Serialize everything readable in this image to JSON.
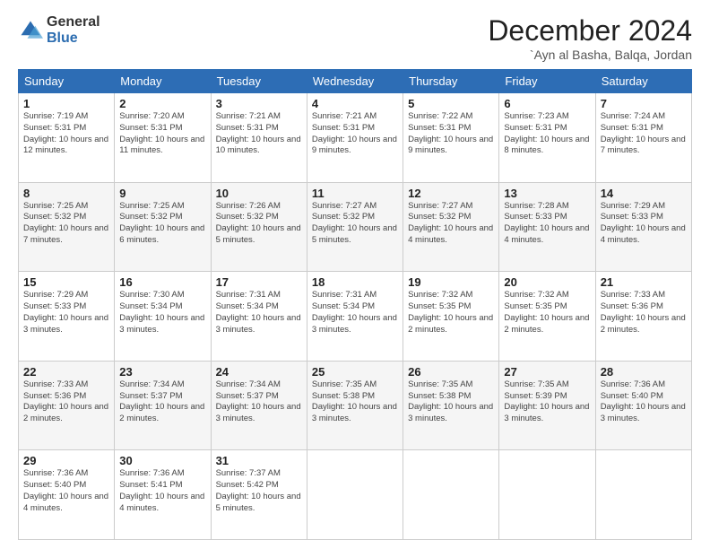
{
  "logo": {
    "general": "General",
    "blue": "Blue"
  },
  "title": "December 2024",
  "location": "`Ayn al Basha, Balqa, Jordan",
  "days_of_week": [
    "Sunday",
    "Monday",
    "Tuesday",
    "Wednesday",
    "Thursday",
    "Friday",
    "Saturday"
  ],
  "weeks": [
    [
      {
        "day": "1",
        "sunrise": "7:19 AM",
        "sunset": "5:31 PM",
        "daylight": "10 hours and 12 minutes."
      },
      {
        "day": "2",
        "sunrise": "7:20 AM",
        "sunset": "5:31 PM",
        "daylight": "10 hours and 11 minutes."
      },
      {
        "day": "3",
        "sunrise": "7:21 AM",
        "sunset": "5:31 PM",
        "daylight": "10 hours and 10 minutes."
      },
      {
        "day": "4",
        "sunrise": "7:21 AM",
        "sunset": "5:31 PM",
        "daylight": "10 hours and 9 minutes."
      },
      {
        "day": "5",
        "sunrise": "7:22 AM",
        "sunset": "5:31 PM",
        "daylight": "10 hours and 9 minutes."
      },
      {
        "day": "6",
        "sunrise": "7:23 AM",
        "sunset": "5:31 PM",
        "daylight": "10 hours and 8 minutes."
      },
      {
        "day": "7",
        "sunrise": "7:24 AM",
        "sunset": "5:31 PM",
        "daylight": "10 hours and 7 minutes."
      }
    ],
    [
      {
        "day": "8",
        "sunrise": "7:25 AM",
        "sunset": "5:32 PM",
        "daylight": "10 hours and 7 minutes."
      },
      {
        "day": "9",
        "sunrise": "7:25 AM",
        "sunset": "5:32 PM",
        "daylight": "10 hours and 6 minutes."
      },
      {
        "day": "10",
        "sunrise": "7:26 AM",
        "sunset": "5:32 PM",
        "daylight": "10 hours and 5 minutes."
      },
      {
        "day": "11",
        "sunrise": "7:27 AM",
        "sunset": "5:32 PM",
        "daylight": "10 hours and 5 minutes."
      },
      {
        "day": "12",
        "sunrise": "7:27 AM",
        "sunset": "5:32 PM",
        "daylight": "10 hours and 4 minutes."
      },
      {
        "day": "13",
        "sunrise": "7:28 AM",
        "sunset": "5:33 PM",
        "daylight": "10 hours and 4 minutes."
      },
      {
        "day": "14",
        "sunrise": "7:29 AM",
        "sunset": "5:33 PM",
        "daylight": "10 hours and 4 minutes."
      }
    ],
    [
      {
        "day": "15",
        "sunrise": "7:29 AM",
        "sunset": "5:33 PM",
        "daylight": "10 hours and 3 minutes."
      },
      {
        "day": "16",
        "sunrise": "7:30 AM",
        "sunset": "5:34 PM",
        "daylight": "10 hours and 3 minutes."
      },
      {
        "day": "17",
        "sunrise": "7:31 AM",
        "sunset": "5:34 PM",
        "daylight": "10 hours and 3 minutes."
      },
      {
        "day": "18",
        "sunrise": "7:31 AM",
        "sunset": "5:34 PM",
        "daylight": "10 hours and 3 minutes."
      },
      {
        "day": "19",
        "sunrise": "7:32 AM",
        "sunset": "5:35 PM",
        "daylight": "10 hours and 2 minutes."
      },
      {
        "day": "20",
        "sunrise": "7:32 AM",
        "sunset": "5:35 PM",
        "daylight": "10 hours and 2 minutes."
      },
      {
        "day": "21",
        "sunrise": "7:33 AM",
        "sunset": "5:36 PM",
        "daylight": "10 hours and 2 minutes."
      }
    ],
    [
      {
        "day": "22",
        "sunrise": "7:33 AM",
        "sunset": "5:36 PM",
        "daylight": "10 hours and 2 minutes."
      },
      {
        "day": "23",
        "sunrise": "7:34 AM",
        "sunset": "5:37 PM",
        "daylight": "10 hours and 2 minutes."
      },
      {
        "day": "24",
        "sunrise": "7:34 AM",
        "sunset": "5:37 PM",
        "daylight": "10 hours and 3 minutes."
      },
      {
        "day": "25",
        "sunrise": "7:35 AM",
        "sunset": "5:38 PM",
        "daylight": "10 hours and 3 minutes."
      },
      {
        "day": "26",
        "sunrise": "7:35 AM",
        "sunset": "5:38 PM",
        "daylight": "10 hours and 3 minutes."
      },
      {
        "day": "27",
        "sunrise": "7:35 AM",
        "sunset": "5:39 PM",
        "daylight": "10 hours and 3 minutes."
      },
      {
        "day": "28",
        "sunrise": "7:36 AM",
        "sunset": "5:40 PM",
        "daylight": "10 hours and 3 minutes."
      }
    ],
    [
      {
        "day": "29",
        "sunrise": "7:36 AM",
        "sunset": "5:40 PM",
        "daylight": "10 hours and 4 minutes."
      },
      {
        "day": "30",
        "sunrise": "7:36 AM",
        "sunset": "5:41 PM",
        "daylight": "10 hours and 4 minutes."
      },
      {
        "day": "31",
        "sunrise": "7:37 AM",
        "sunset": "5:42 PM",
        "daylight": "10 hours and 5 minutes."
      },
      null,
      null,
      null,
      null
    ]
  ]
}
